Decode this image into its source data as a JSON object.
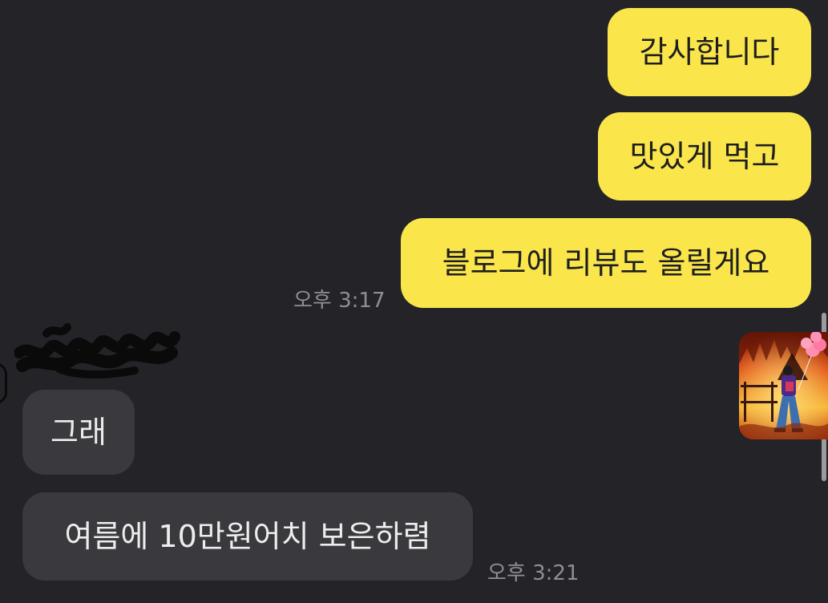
{
  "messages_out": [
    {
      "text": "감사합니다"
    },
    {
      "text": "맛있게 먹고"
    },
    {
      "text": "블로그에 리뷰도 올릴게요"
    }
  ],
  "time_out": "오후 3:17",
  "messages_in": [
    {
      "text": "그래"
    },
    {
      "text": "여름에 10만원어치 보은하렴"
    }
  ],
  "time_in": "오후 3:21",
  "colors": {
    "background": "#242428",
    "outgoing_bubble": "#FAE64B",
    "incoming_bubble": "#3A3A3E",
    "timestamp": "#8E8E93"
  },
  "icons": {
    "sender_name": "redacted-scribble",
    "sender_avatar": "avatar-icon",
    "emoticon": "fire-emoticon-sticker"
  }
}
